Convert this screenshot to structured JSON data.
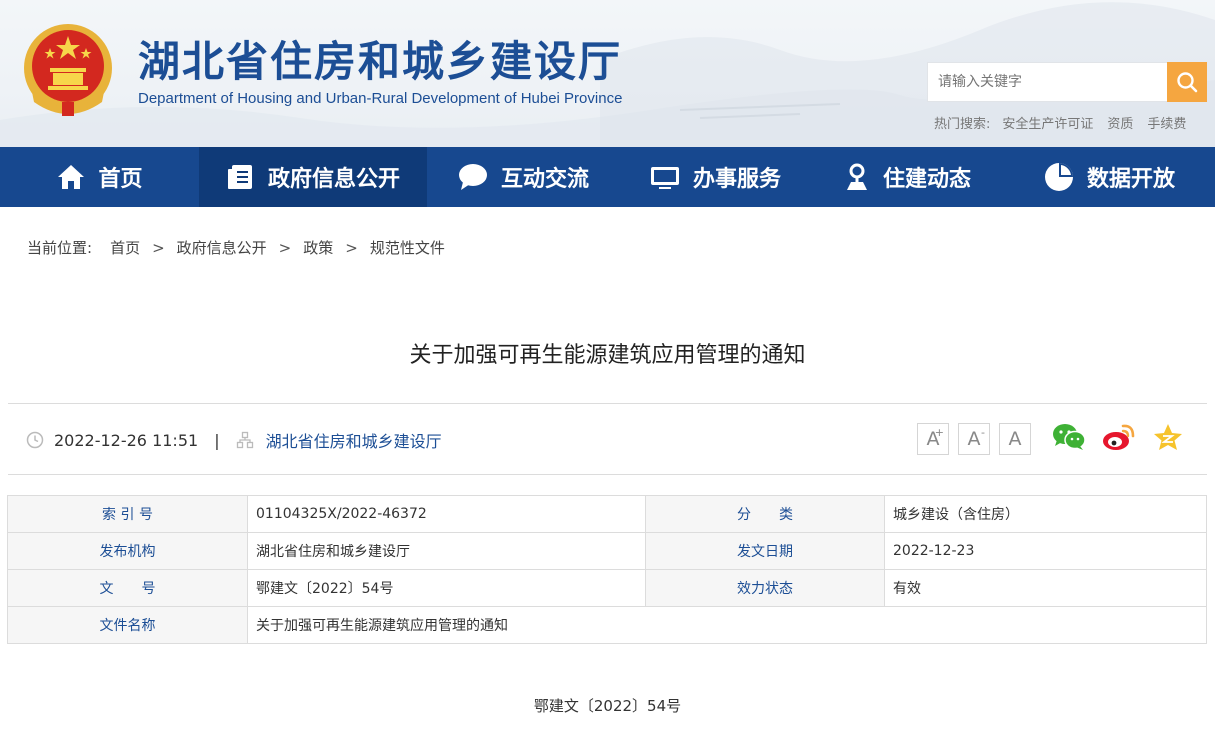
{
  "header": {
    "title": "湖北省住房和城乡建设厅",
    "subtitle": "Department of Housing and Urban-Rural Development of Hubei Province",
    "search_placeholder": "请输入关键字",
    "hot_search_label": "热门搜索:",
    "hot_search_items": [
      "安全生产许可证",
      "资质",
      "手续费"
    ]
  },
  "nav": {
    "items": [
      "首页",
      "政府信息公开",
      "互动交流",
      "办事服务",
      "住建动态",
      "数据开放"
    ],
    "active_index": 1
  },
  "breadcrumb": {
    "label": "当前位置:",
    "items": [
      "首页",
      "政府信息公开",
      "政策",
      "规范性文件"
    ],
    "separator": ">"
  },
  "article": {
    "title": "关于加强可再生能源建筑应用管理的通知",
    "datetime": "2022-12-26 11:51",
    "separator": "|",
    "source": "湖北省住房和城乡建设厅",
    "font_sizes": [
      "A",
      "A",
      "A"
    ],
    "doc_number": "鄂建文〔2022〕54号"
  },
  "info_table": {
    "rows": [
      {
        "k1": "索 引 号",
        "v1": "01104325X/2022-46372",
        "k2": "分　　类",
        "v2": "城乡建设（含住房）"
      },
      {
        "k1": "发布机构",
        "v1": "湖北省住房和城乡建设厅",
        "k2": "发文日期",
        "v2": "2022-12-23"
      },
      {
        "k1": "文　　号",
        "v1": "鄂建文〔2022〕54号",
        "k2": "效力状态",
        "v2": "有效"
      },
      {
        "k1": "文件名称",
        "v1": "关于加强可再生能源建筑应用管理的通知"
      }
    ]
  },
  "colors": {
    "primary": "#17488f",
    "accent": "#f5a640",
    "title": "#1c4e95"
  },
  "icons": {
    "emblem": "national-emblem-icon",
    "search": "search-icon",
    "nav": [
      "home-icon",
      "document-list-icon",
      "chat-bubble-icon",
      "monitor-icon",
      "person-pin-icon",
      "pie-chart-icon"
    ],
    "meta": [
      "clock-icon",
      "org-chart-icon"
    ],
    "share": [
      "wechat-icon",
      "weibo-icon",
      "qzone-star-icon"
    ]
  }
}
